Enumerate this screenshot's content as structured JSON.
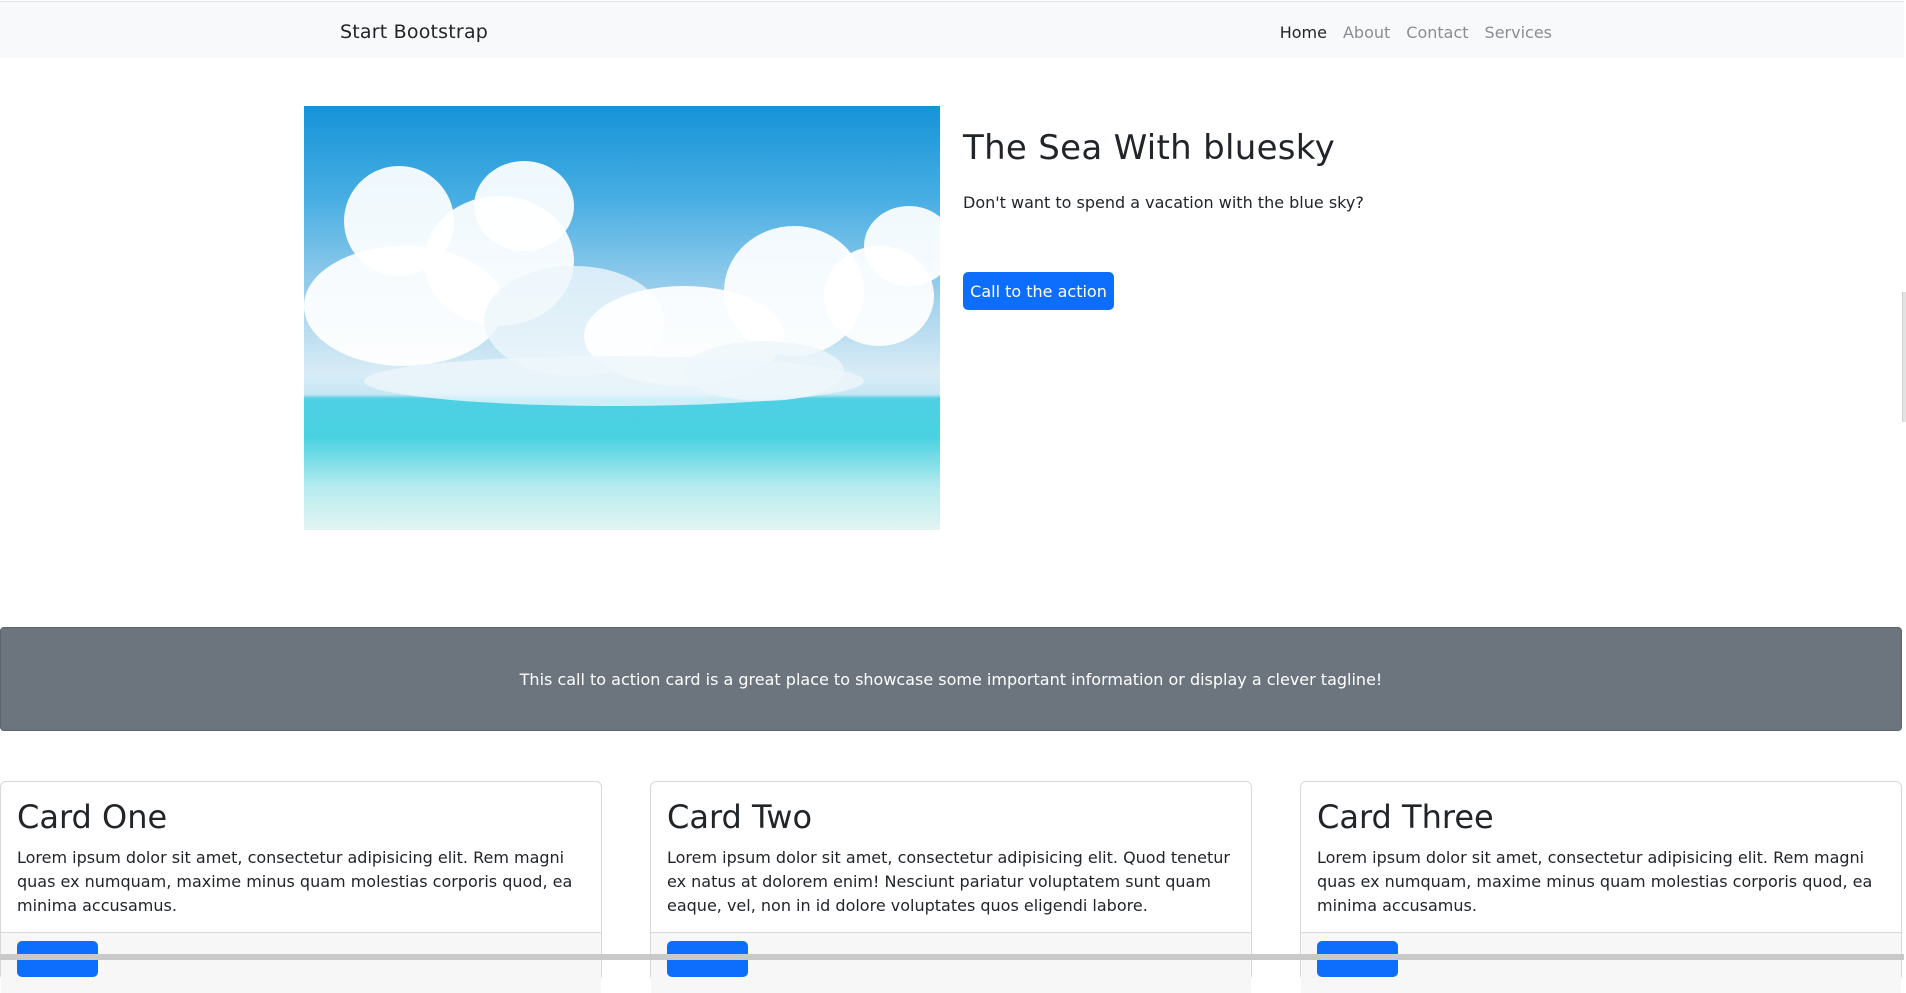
{
  "navbar": {
    "brand": "Start Bootstrap",
    "links": [
      {
        "label": "Home",
        "active": true
      },
      {
        "label": "About",
        "active": false
      },
      {
        "label": "Contact",
        "active": false
      },
      {
        "label": "Services",
        "active": false
      }
    ]
  },
  "hero": {
    "image_alt": "sea-with-clouds-image",
    "title": "The Sea With bluesky",
    "text": "Don't want to spend a vacation with the blue sky?",
    "button_label": "Call to the action"
  },
  "cta": {
    "text": "This call to action card is a great place to showcase some important information or display a clever tagline!"
  },
  "cards": [
    {
      "title": "Card One",
      "text": "Lorem ipsum dolor sit amet, consectetur adipisicing elit. Rem magni quas ex numquam, maxime minus quam molestias corporis quod, ea minima accusamus."
    },
    {
      "title": "Card Two",
      "text": "Lorem ipsum dolor sit amet, consectetur adipisicing elit. Quod tenetur ex natus at dolorem enim! Nesciunt pariatur voluptatem sunt quam eaque, vel, non in id dolore voluptates quos eligendi labore."
    },
    {
      "title": "Card Three",
      "text": "Lorem ipsum dolor sit amet, consectetur adipisicing elit. Rem magni quas ex numquam, maxime minus quam molestias corporis quod, ea minima accusamus."
    }
  ],
  "colors": {
    "primary": "#0d6efd",
    "navbar_bg": "#f8f9fa",
    "cta_bg": "#6c757d"
  }
}
